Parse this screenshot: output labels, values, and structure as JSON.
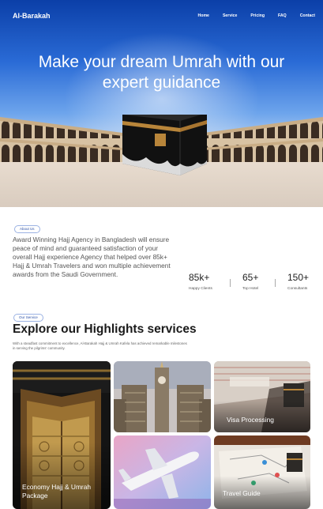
{
  "header": {
    "brand": "Al-Barakah",
    "nav": [
      "Home",
      "Service",
      "Pricing",
      "FAQ",
      "Contact"
    ]
  },
  "hero": {
    "title": "Make your dream Umrah with our expert guidance"
  },
  "about": {
    "tag": "About Us",
    "text": "Award Winning Hajj Agency in Bangladesh will ensure peace of mind and guaranteed satisfaction of your overall Hajj experience Agency that helped over 85k+ Hajj & Umrah Travelers and won multiple achievement awards from the Saudi Government.",
    "stats": [
      {
        "value": "85k+",
        "label": "Happy Clients"
      },
      {
        "value": "65+",
        "label": "Top Hotel"
      },
      {
        "value": "150+",
        "label": "Consultants"
      }
    ]
  },
  "services": {
    "tag": "Our Service",
    "title": "Explore our Highlights services",
    "description": "With a steadfast commitment to excellence, Al-Barakah Hajj & Umrah Kafela has achieved remarkable milestones in serving the pilgrims' community.",
    "cards": [
      {
        "caption": "Economy Hajj & Umrah Package"
      },
      {
        "caption": ""
      },
      {
        "caption": "Visa Processing"
      },
      {
        "caption": ""
      },
      {
        "caption": "Travel Guide"
      }
    ]
  }
}
